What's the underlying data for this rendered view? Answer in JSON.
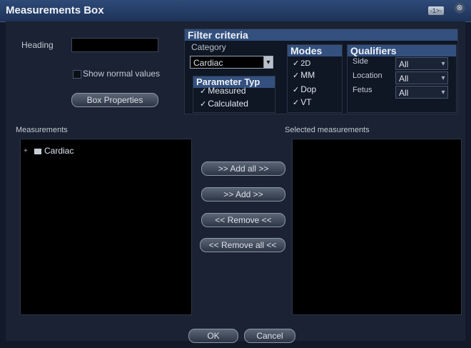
{
  "window": {
    "title": "Measurements Box",
    "titlebar_button_label": "-1>-",
    "close_glyph": "⊗"
  },
  "heading": {
    "label": "Heading",
    "value": ""
  },
  "show_normal_values": {
    "label": "Show normal values",
    "checked": false
  },
  "box_properties_label": "Box Properties",
  "filter": {
    "title": "Filter criteria",
    "category_label": "Category",
    "category_value": "Cardiac",
    "parameter_type": {
      "title": "Parameter Typ",
      "options": [
        {
          "label": "Measured",
          "checked": true
        },
        {
          "label": "Calculated",
          "checked": true
        }
      ]
    },
    "modes": {
      "title": "Modes",
      "options": [
        {
          "label": "2D",
          "checked": true
        },
        {
          "label": "MM",
          "checked": true
        },
        {
          "label": "Dop",
          "checked": true
        },
        {
          "label": "VT",
          "checked": true
        }
      ]
    },
    "qualifiers": {
      "title": "Qualifiers",
      "fields": [
        {
          "label": "Side",
          "value": "All"
        },
        {
          "label": "Location",
          "value": "All"
        },
        {
          "label": "Fetus",
          "value": "All"
        }
      ]
    }
  },
  "measurements": {
    "label": "Measurements",
    "tree": [
      {
        "label": "Cardiac",
        "expander": "+"
      }
    ]
  },
  "selected_measurements": {
    "label": "Selected measurements",
    "items": []
  },
  "transfer_buttons": {
    "add_all": ">> Add all >>",
    "add": ">> Add >>",
    "remove": "<< Remove <<",
    "remove_all": "<< Remove all <<"
  },
  "footer": {
    "ok": "OK",
    "cancel": "Cancel"
  },
  "icons": {
    "dropdown": "dropdown-arrow-icon",
    "tree_item": "document-icon",
    "close": "close-icon",
    "minimize": "minimize-icon"
  },
  "colors": {
    "titlebar": "#2e4a78",
    "panel_header": "#33507e",
    "background": "#1a2233",
    "list_background": "#000000"
  }
}
